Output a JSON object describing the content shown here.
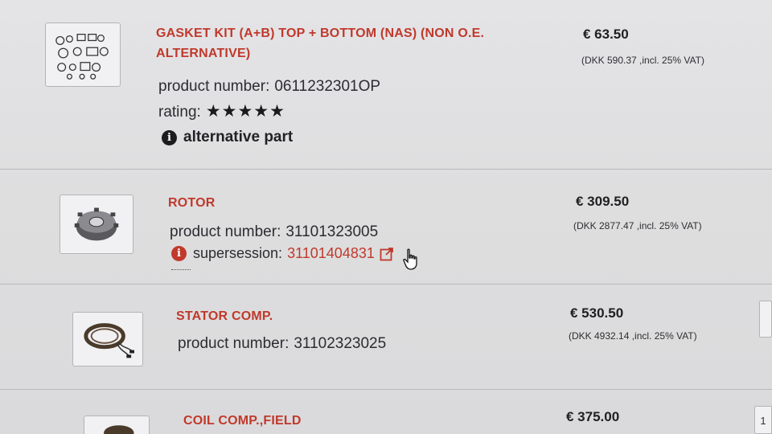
{
  "products": [
    {
      "title_line1": "GASKET KIT (A+B) TOP + BOTTOM (NAS) (NON O.E.",
      "title_line2": "ALTERNATIVE)",
      "product_number_label": "product number:",
      "product_number": "0611232301OP",
      "rating_label": "rating:",
      "rating_stars": "★★★★★",
      "rating_value": 5,
      "alternative_label": "alternative part",
      "price": "€ 63.50",
      "vat": "(DKK 590.37 ,incl. 25% VAT)",
      "thumbnail_icon": "gasket-kit-image"
    },
    {
      "title_line1": "ROTOR",
      "product_number_label": "product number:",
      "product_number": "31101323005",
      "supersession_label": "supersession:",
      "supersession_link": "31101404831",
      "price": "€ 309.50",
      "vat": "(DKK 2877.47 ,incl. 25% VAT)",
      "thumbnail_icon": "rotor-image"
    },
    {
      "title_line1": "STATOR COMP.",
      "product_number_label": "product number:",
      "product_number": "31102323025",
      "price": "€ 530.50",
      "vat": "(DKK 4932.14 ,incl. 25% VAT)",
      "thumbnail_icon": "stator-image"
    },
    {
      "title_line1": "COIL COMP.,FIELD",
      "price": "€ 375.00",
      "thumbnail_icon": "coil-image"
    }
  ],
  "side_quantity": "1",
  "icons": {
    "info": "info-icon",
    "external_link": "external-link-icon",
    "cursor": "hand-pointer-icon"
  },
  "colors": {
    "title": "#c0392b",
    "link": "#c0392b",
    "text": "#2c2c31"
  }
}
